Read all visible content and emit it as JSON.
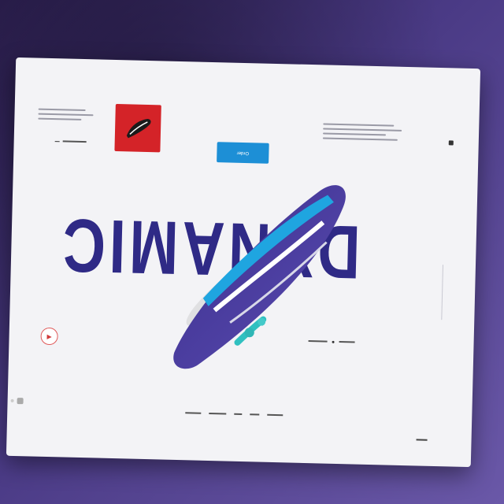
{
  "hero": {
    "headline": "DYNAMIC",
    "cta_label": "Order"
  },
  "colors": {
    "background": "#4a3a85",
    "card": "#f3f3f6",
    "headline": "#2f2a86",
    "cta": "#1d8fd6",
    "product_box": "#d42328"
  },
  "icons": {
    "menu": "menu-icon",
    "play": "play-icon",
    "product": "sneaker-thumbnail"
  }
}
